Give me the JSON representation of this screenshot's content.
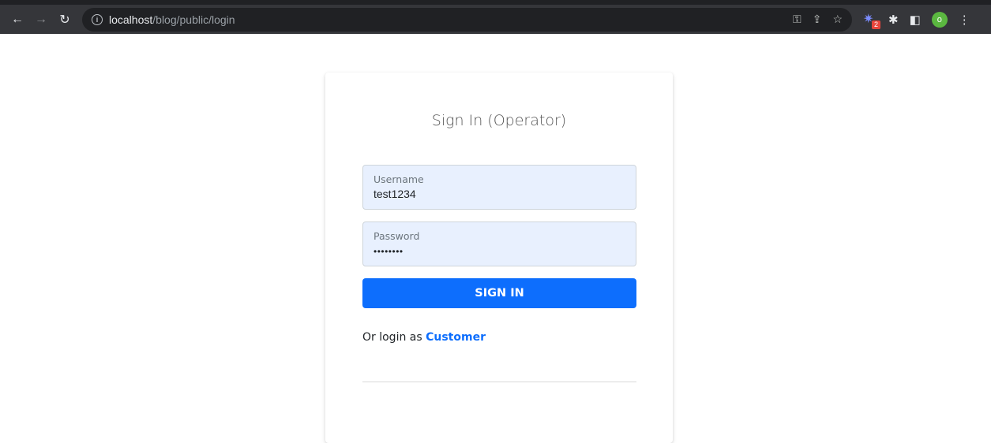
{
  "browser": {
    "url_host": "localhost",
    "url_path": "/blog/public/login",
    "extension_badge": "2",
    "profile_initial": "o"
  },
  "login": {
    "title": "Sign In (Operator)",
    "username_label": "Username",
    "username_value": "test1234",
    "password_label": "Password",
    "password_value": "••••••••",
    "submit_label": "SIGN IN",
    "alt_prefix": "Or login as",
    "alt_link": "Customer"
  },
  "colors": {
    "primary": "#0d6efd",
    "field_bg": "#e8f0fe"
  }
}
